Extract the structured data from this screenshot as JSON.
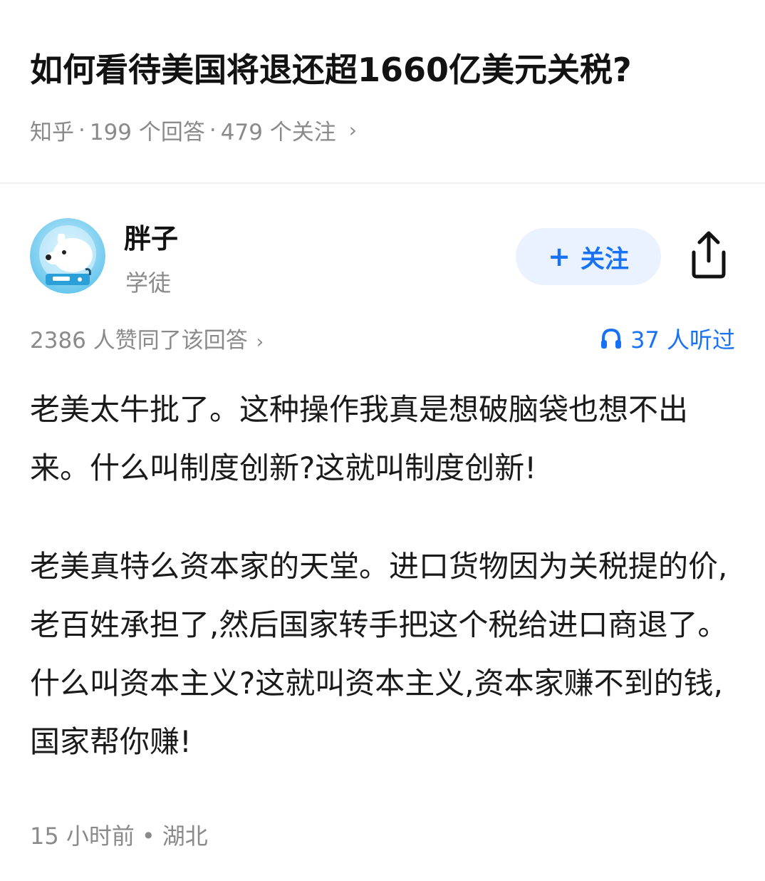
{
  "question": {
    "title": "如何看待美国将退还超1660亿美元关税?",
    "source": "知乎",
    "answers": "199 个回答",
    "followers": "479 个关注",
    "separator": "·",
    "chevron": "›"
  },
  "author": {
    "name": "胖子",
    "title": "学徒",
    "avatar_icon": "dog-astronaut-avatar",
    "follow_label": "关注",
    "follow_icon": "plus-icon",
    "share_icon": "share-icon"
  },
  "stats": {
    "likes": "2386 人赞同了该回答",
    "chevron": "›",
    "listens": "37 人听过",
    "listen_icon": "headphones-icon"
  },
  "answer": {
    "paragraph1": "老美太牛批了。这种操作我真是想破脑袋也想不出来。什么叫制度创新?这就叫制度创新!",
    "paragraph2": "老美真特么资本家的天堂。进口货物因为关税提的价,老百姓承担了,然后国家转手把这个税给进口商退了。什么叫资本主义?这就叫资本主义,资本家赚不到的钱,国家帮你赚!"
  },
  "footer": {
    "time": "15 小时前",
    "dot": "•",
    "location": "湖北"
  },
  "colors": {
    "accent": "#1772f6",
    "follow_bg": "#eaf2ff",
    "muted_text": "#8a8a8a",
    "main_text": "#121212"
  }
}
